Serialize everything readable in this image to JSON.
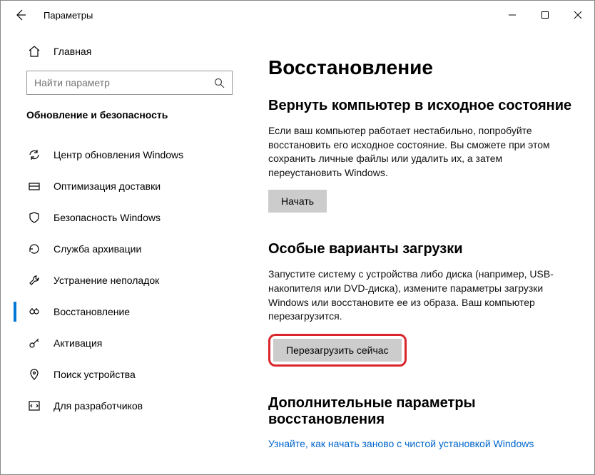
{
  "titlebar": {
    "title": "Параметры"
  },
  "sidebar": {
    "home": "Главная",
    "search_placeholder": "Найти параметр",
    "category": "Обновление и безопасность",
    "items": [
      {
        "label": "Центр обновления Windows"
      },
      {
        "label": "Оптимизация доставки"
      },
      {
        "label": "Безопасность Windows"
      },
      {
        "label": "Служба архивации"
      },
      {
        "label": "Устранение неполадок"
      },
      {
        "label": "Восстановление"
      },
      {
        "label": "Активация"
      },
      {
        "label": "Поиск устройства"
      },
      {
        "label": "Для разработчиков"
      }
    ]
  },
  "content": {
    "heading": "Восстановление",
    "reset": {
      "title": "Вернуть компьютер в исходное состояние",
      "desc": "Если ваш компьютер работает нестабильно, попробуйте восстановить его исходное состояние. Вы сможете при этом сохранить личные файлы или удалить их, а затем переустановить Windows.",
      "button": "Начать"
    },
    "advanced": {
      "title": "Особые варианты загрузки",
      "desc": "Запустите систему с устройства либо диска (например, USB-накопителя или DVD-диска), измените параметры загрузки Windows или восстановите ее из образа. Ваш компьютер перезагрузится.",
      "button": "Перезагрузить сейчас"
    },
    "more": {
      "title": "Дополнительные параметры восстановления",
      "link": "Узнайте, как начать заново с чистой установкой Windows"
    }
  }
}
